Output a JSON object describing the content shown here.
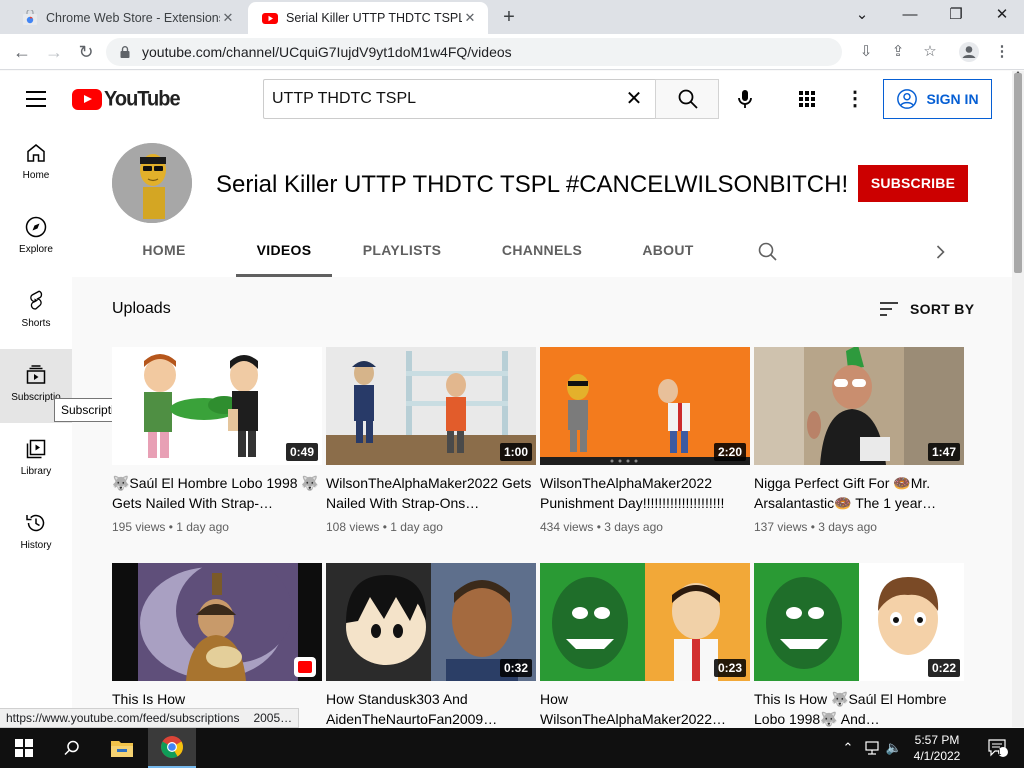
{
  "browser": {
    "tabs": [
      {
        "title": "Chrome Web Store - Extensions",
        "active": false
      },
      {
        "title": "Serial Killer UTTP THDTC TSPL #C",
        "active": true
      }
    ],
    "url": "youtube.com/channel/UCquiG7IujdV9yt1doM1w4FQ/videos",
    "status_url": "https://www.youtube.com/feed/subscriptions"
  },
  "youtube": {
    "logo_text": "YouTube",
    "search_value": "UTTP THDTC TSPL",
    "signin_label": "SIGN IN",
    "guide": [
      {
        "label": "Home",
        "icon": "home-icon"
      },
      {
        "label": "Explore",
        "icon": "explore-icon"
      },
      {
        "label": "Shorts",
        "icon": "shorts-icon"
      },
      {
        "label": "Subscriptio",
        "icon": "subscriptions-icon"
      },
      {
        "label": "Library",
        "icon": "library-icon"
      },
      {
        "label": "History",
        "icon": "history-icon"
      }
    ],
    "tooltip": "Subscriptions"
  },
  "channel": {
    "title": "Serial Killer UTTP THDTC TSPL #CANCELWILSONBITCH!",
    "subscribe_label": "SUBSCRIBE",
    "tabs": [
      "HOME",
      "VIDEOS",
      "PLAYLISTS",
      "CHANNELS",
      "ABOUT"
    ],
    "selected_tab": "VIDEOS"
  },
  "content": {
    "section_title": "Uploads",
    "sort_label": "SORT BY",
    "videos": [
      {
        "title": "🐺Saúl El Hombre Lobo 1998 🐺 Gets Nailed With Strap-…",
        "meta": "195 views • 1 day ago",
        "duration": "0:49"
      },
      {
        "title": "WilsonTheAlphaMaker2022 Gets Nailed With Strap-Ons…",
        "meta": "108 views • 1 day ago",
        "duration": "1:00"
      },
      {
        "title": "WilsonTheAlphaMaker2022 Punishment Day!!!!!!!!!!!!!!!!!!!!!",
        "meta": "434 views • 3 days ago",
        "duration": "2:20"
      },
      {
        "title": "Nigga Perfect Gift For 🍩Mr. Arsalantastic🍩 The 1 year…",
        "meta": "137 views • 3 days ago",
        "duration": "1:47"
      },
      {
        "title": "This Is How ",
        "meta": "",
        "duration": ""
      },
      {
        "title": "How Standusk303 And AidenTheNaurtoFan2009…",
        "meta": "",
        "duration": "0:32"
      },
      {
        "title": "How WilsonTheAlphaMaker2022…",
        "meta": "",
        "duration": "0:23"
      },
      {
        "title": "This Is How 🐺Saúl El Hombre Lobo 1998🐺 And…",
        "meta": "",
        "duration": "0:22"
      }
    ],
    "partial_title_2005": "2005…"
  },
  "taskbar": {
    "time": "5:57 PM",
    "date": "4/1/2022",
    "notification_count": "1"
  }
}
